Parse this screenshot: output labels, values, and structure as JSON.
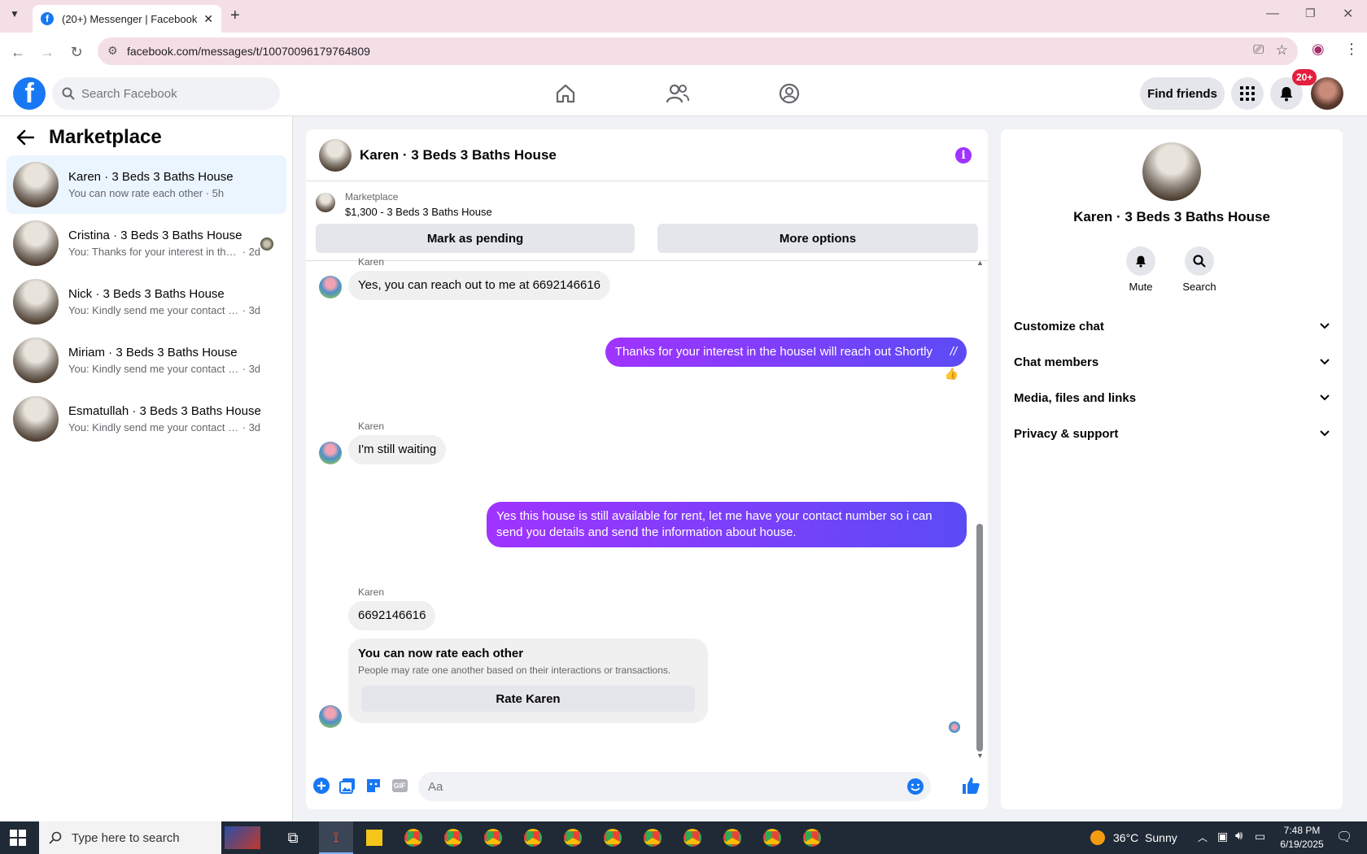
{
  "browser": {
    "tab_title": "(20+) Messenger | Facebook",
    "url": "facebook.com/messages/t/10070096179764809"
  },
  "header": {
    "search_placeholder": "Search Facebook",
    "find_friends": "Find friends",
    "notif_badge": "20+"
  },
  "sidebar": {
    "title": "Marketplace",
    "conversations": [
      {
        "name": "Karen · 3 Beds 3 Baths House",
        "preview": "You can now rate each other",
        "time": "· 5h"
      },
      {
        "name": "Cristina · 3 Beds 3 Baths House",
        "preview": "You: Thanks for your interest in the...",
        "time": "· 2d"
      },
      {
        "name": "Nick · 3 Beds 3 Baths House",
        "preview": "You: Kindly send me your contact nu...",
        "time": "· 3d"
      },
      {
        "name": "Miriam · 3 Beds 3 Baths House",
        "preview": "You: Kindly send me your contact nu...",
        "time": "· 3d"
      },
      {
        "name": "Esmatullah · 3 Beds 3 Baths House",
        "preview": "You: Kindly send me your contact nu...",
        "time": "· 3d"
      }
    ]
  },
  "chat": {
    "title": "Karen · 3 Beds 3 Baths House",
    "listing_label": "Marketplace",
    "listing_price": "$1,300 - 3 Beds 3 Baths House",
    "mark_pending": "Mark as pending",
    "more_options": "More options",
    "messages": {
      "m1_sender": "Karen",
      "m1_text": "Yes, you can reach out to me at 6692146616",
      "m2_text": "Thanks for your interest in the houseI will reach out Shortly",
      "m2_slash": "//",
      "m3_sender": "Karen",
      "m3_text": "I'm still waiting",
      "m4_text": "Yes this house is still available for rent, let me have your contact number so i can send you details and send the information about house.",
      "m5_sender": "Karen",
      "m5_text": "6692146616"
    },
    "rate_card": {
      "title": "You can now rate each other",
      "desc": "People may rate one another based on their interactions or transactions.",
      "button": "Rate Karen"
    },
    "composer_placeholder": "Aa",
    "gif_label": "GIF"
  },
  "details": {
    "name": "Karen · 3 Beds 3 Baths House",
    "mute": "Mute",
    "search": "Search",
    "sections": [
      "Customize chat",
      "Chat members",
      "Media, files and links",
      "Privacy & support"
    ]
  },
  "taskbar": {
    "search_placeholder": "Type here to search",
    "weather": "36°C  Sunny",
    "time": "7:48 PM",
    "date": "6/19/2025"
  }
}
